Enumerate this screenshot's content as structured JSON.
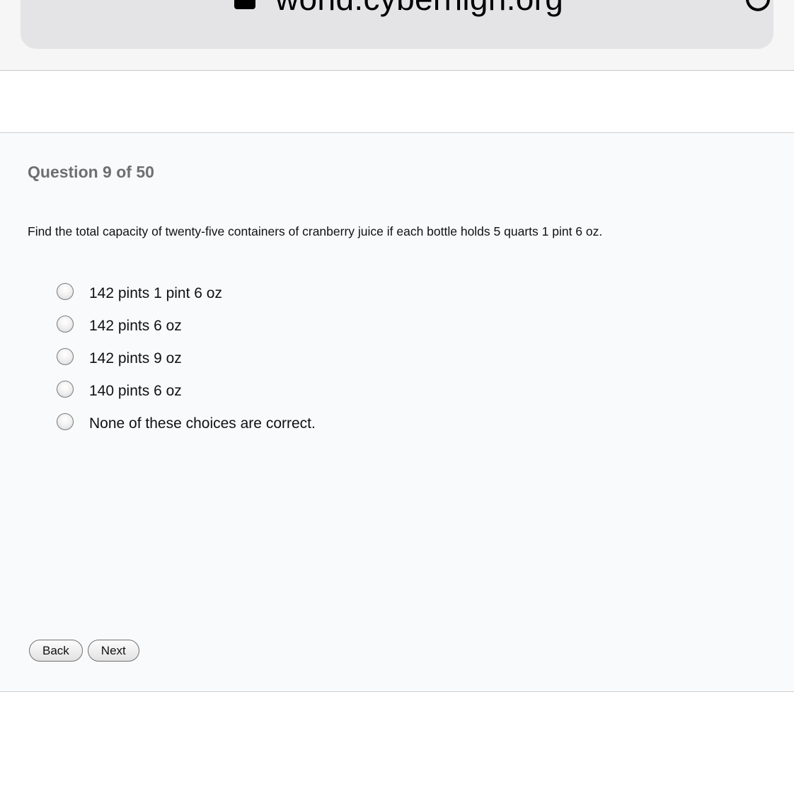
{
  "browser": {
    "url": "world.cyberhigh.org",
    "lock_icon": "lock-icon",
    "reload_icon": "reload-icon"
  },
  "quiz": {
    "title": "Question 9 of 50",
    "question": "Find the total capacity of twenty-five containers of cranberry juice if each bottle holds 5 quarts 1 pint 6 oz.",
    "options": [
      "142 pints 1 pint 6 oz",
      "142 pints 6 oz",
      "142 pints 9 oz",
      "140 pints 6 oz",
      "None of these choices are correct."
    ],
    "selected": null,
    "back_label": "Back",
    "next_label": "Next"
  },
  "colors": {
    "panel_background": "#f9fafc",
    "title_gray": "#6f6f6f",
    "url_bar": "#e4e4e6"
  }
}
